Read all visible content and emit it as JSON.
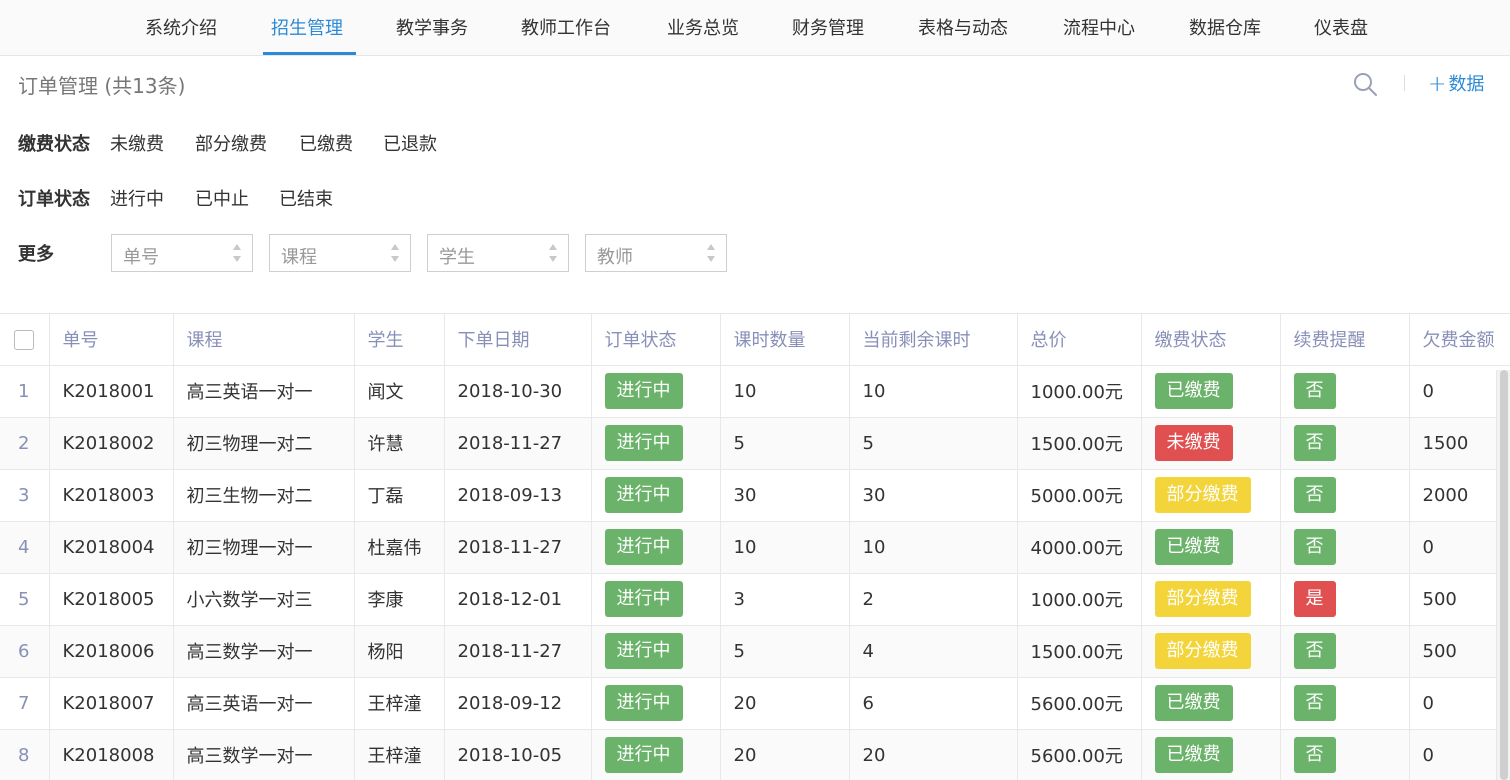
{
  "nav": {
    "tabs": [
      "系统介绍",
      "招生管理",
      "教学事务",
      "教师工作台",
      "业务总览",
      "财务管理",
      "表格与动态",
      "流程中心",
      "数据仓库",
      "仪表盘"
    ],
    "active_index": 1
  },
  "header": {
    "title": "订单管理 (共13条)",
    "add_label": "数据",
    "search_icon": "search-icon",
    "add_icon": "plus-icon"
  },
  "filters": {
    "payment": {
      "label": "缴费状态",
      "options": [
        "未缴费",
        "部分缴费",
        "已缴费",
        "已退款"
      ]
    },
    "order": {
      "label": "订单状态",
      "options": [
        "进行中",
        "已中止",
        "已结束"
      ]
    },
    "more": {
      "label": "更多",
      "selects": [
        "单号",
        "课程",
        "学生",
        "教师"
      ]
    }
  },
  "table": {
    "columns": [
      "单号",
      "课程",
      "学生",
      "下单日期",
      "订单状态",
      "课时数量",
      "当前剩余课时",
      "总价",
      "缴费状态",
      "续费提醒",
      "欠费金额"
    ],
    "rows": [
      {
        "idx": "1",
        "id": "K2018001",
        "course": "高三英语一对一",
        "student": "闻文",
        "date": "2018-10-30",
        "order_status": "进行中",
        "hours": "10",
        "remaining": "10",
        "total": "1000.00元",
        "pay_status": "已缴费",
        "pay_color": "green",
        "renew": "否",
        "renew_color": "green",
        "owed": "0"
      },
      {
        "idx": "2",
        "id": "K2018002",
        "course": "初三物理一对二",
        "student": "许慧",
        "date": "2018-11-27",
        "order_status": "进行中",
        "hours": "5",
        "remaining": "5",
        "total": "1500.00元",
        "pay_status": "未缴费",
        "pay_color": "red",
        "renew": "否",
        "renew_color": "green",
        "owed": "1500"
      },
      {
        "idx": "3",
        "id": "K2018003",
        "course": "初三生物一对二",
        "student": "丁磊",
        "date": "2018-09-13",
        "order_status": "进行中",
        "hours": "30",
        "remaining": "30",
        "total": "5000.00元",
        "pay_status": "部分缴费",
        "pay_color": "yellow",
        "renew": "否",
        "renew_color": "green",
        "owed": "2000"
      },
      {
        "idx": "4",
        "id": "K2018004",
        "course": "初三物理一对一",
        "student": "杜嘉伟",
        "date": "2018-11-27",
        "order_status": "进行中",
        "hours": "10",
        "remaining": "10",
        "total": "4000.00元",
        "pay_status": "已缴费",
        "pay_color": "green",
        "renew": "否",
        "renew_color": "green",
        "owed": "0"
      },
      {
        "idx": "5",
        "id": "K2018005",
        "course": "小六数学一对三",
        "student": "李康",
        "date": "2018-12-01",
        "order_status": "进行中",
        "hours": "3",
        "remaining": "2",
        "total": "1000.00元",
        "pay_status": "部分缴费",
        "pay_color": "yellow",
        "renew": "是",
        "renew_color": "red",
        "owed": "500"
      },
      {
        "idx": "6",
        "id": "K2018006",
        "course": "高三数学一对一",
        "student": "杨阳",
        "date": "2018-11-27",
        "order_status": "进行中",
        "hours": "5",
        "remaining": "4",
        "total": "1500.00元",
        "pay_status": "部分缴费",
        "pay_color": "yellow",
        "renew": "否",
        "renew_color": "green",
        "owed": "500"
      },
      {
        "idx": "7",
        "id": "K2018007",
        "course": "高三英语一对一",
        "student": "王梓潼",
        "date": "2018-09-12",
        "order_status": "进行中",
        "hours": "20",
        "remaining": "6",
        "total": "5600.00元",
        "pay_status": "已缴费",
        "pay_color": "green",
        "renew": "否",
        "renew_color": "green",
        "owed": "0"
      },
      {
        "idx": "8",
        "id": "K2018008",
        "course": "高三数学一对一",
        "student": "王梓潼",
        "date": "2018-10-05",
        "order_status": "进行中",
        "hours": "20",
        "remaining": "20",
        "total": "5600.00元",
        "pay_status": "已缴费",
        "pay_color": "green",
        "renew": "否",
        "renew_color": "green",
        "owed": "0"
      }
    ]
  },
  "colors": {
    "accent": "#2d8ad6",
    "green": "#6bb36b",
    "red": "#e15050",
    "yellow": "#f3d53b",
    "header_text": "#8890b8"
  }
}
